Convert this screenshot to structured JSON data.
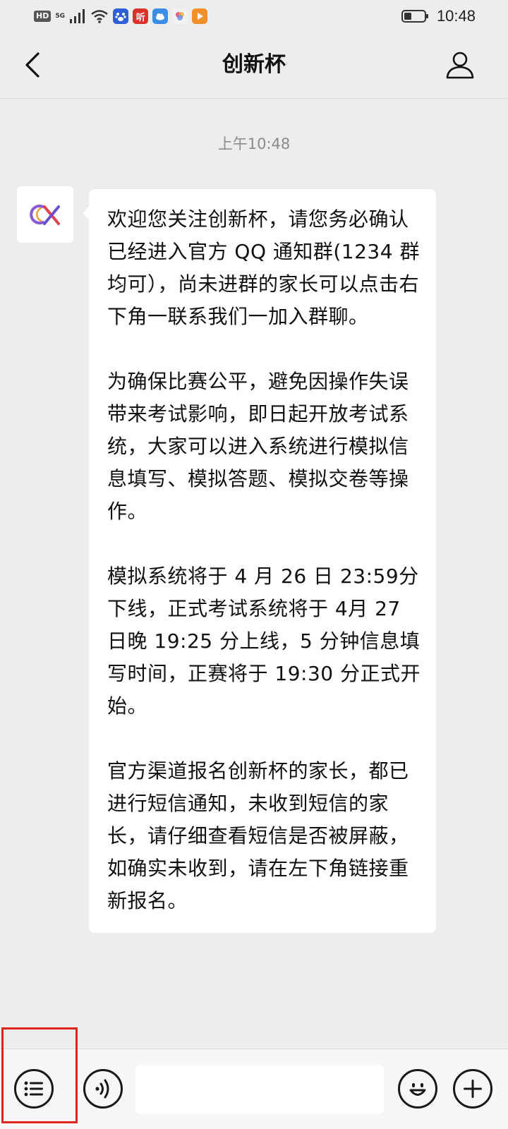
{
  "status_bar": {
    "hd_label": "HD",
    "network_label": "5G",
    "app_icon_listen": "听",
    "time": "10:48",
    "icons": [
      "signal-icon",
      "wifi-icon",
      "baidu-icon",
      "listen-app-icon",
      "cloud-icon",
      "photos-icon",
      "video-icon",
      "battery-icon"
    ]
  },
  "nav": {
    "title": "创新杯",
    "back_icon": "chevron-left-icon",
    "profile_icon": "person-icon"
  },
  "chat": {
    "timestamp": "上午10:48",
    "message": {
      "paragraphs": [
        "欢迎您关注创新杯，请您务必确认已经进入官方 QQ 通知群(1234 群均可），尚未进群的家长可以点击右下角一联系我们一加入群聊。",
        "为确保比赛公平，避免因操作失误带来考试影响，即日起开放考试系统，大家可以进入系统进行模拟信息填写、模拟答题、模拟交卷等操作。",
        "模拟系统将于 4 月 26 日 23:59分下线，正式考试系统将于 4月 27 日晚 19:25 分上线，5 分钟信息填写时间，正赛将于 19:30 分正式开始。",
        "官方渠道报名创新杯的家长，都已进行短信通知，未收到短信的家长，请仔细查看短信是否被屏蔽，如确实未收到，请在左下角链接重新报名。"
      ]
    }
  },
  "input_bar": {
    "input_value": "",
    "icons": [
      "menu-list-icon",
      "voice-icon",
      "emoji-icon",
      "plus-icon"
    ]
  },
  "colors": {
    "background": "#ededed",
    "bubble": "#ffffff",
    "highlight": "#e0231b"
  }
}
